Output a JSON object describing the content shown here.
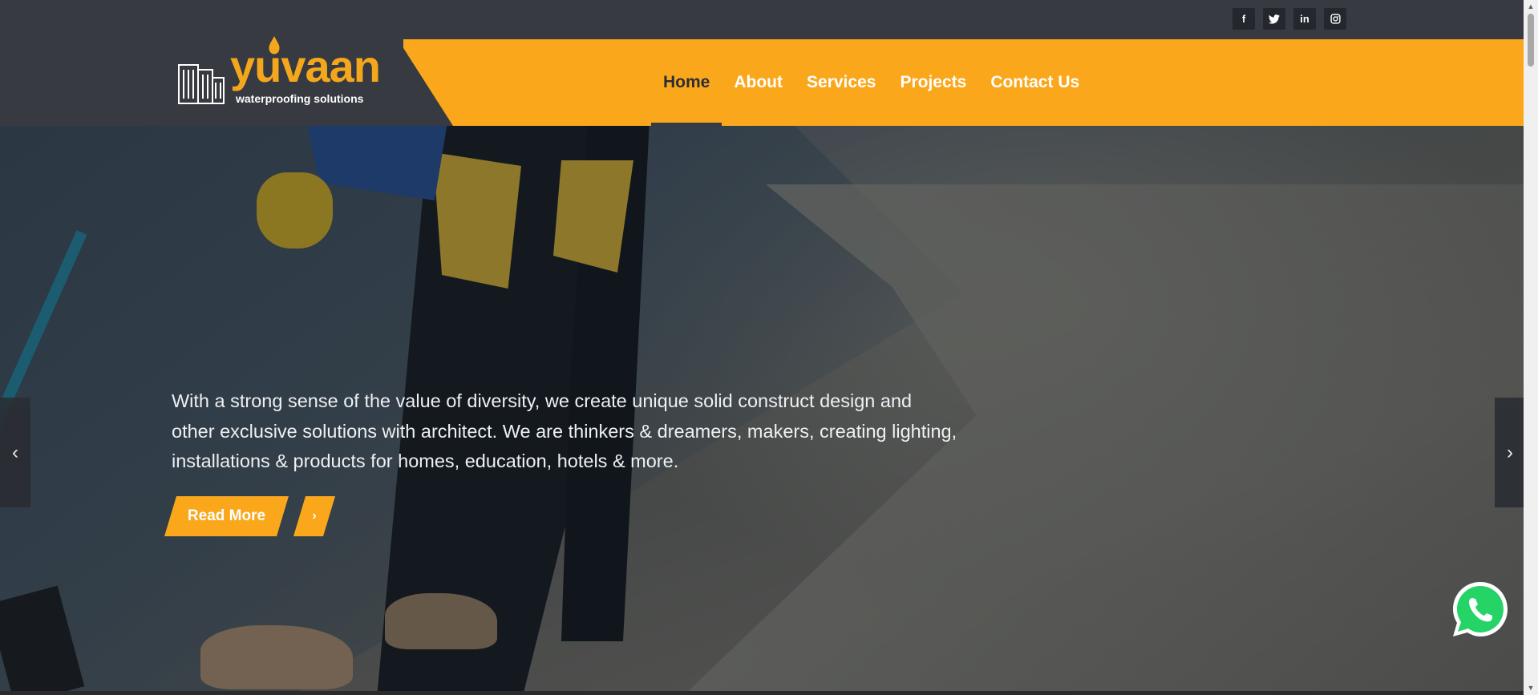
{
  "brand": {
    "name": "yuvaan",
    "tagline": "waterproofing solutions",
    "accent_color": "#fba71c",
    "dark_color": "#373a41"
  },
  "social": [
    {
      "name": "facebook-icon",
      "glyph": "f"
    },
    {
      "name": "twitter-icon",
      "glyph": "🐦"
    },
    {
      "name": "linkedin-icon",
      "glyph": "in"
    },
    {
      "name": "instagram-icon",
      "glyph": "◎"
    }
  ],
  "nav": {
    "items": [
      {
        "label": "Home",
        "active": true
      },
      {
        "label": "About"
      },
      {
        "label": "Services"
      },
      {
        "label": "Projects"
      },
      {
        "label": "Contact Us"
      }
    ]
  },
  "hero": {
    "text": "With a strong sense of the value of diversity, we create unique solid construct design and other exclusive solutions with architect. We are thinkers & dreamers, makers, creating lighting, installations & products for homes, education, hotels & more.",
    "button_label": "Read More",
    "button_arrow": "›"
  },
  "slider": {
    "prev_icon": "‹",
    "next_icon": "›"
  },
  "whatsapp": {
    "icon": "whatsapp-icon",
    "color": "#25d366"
  }
}
